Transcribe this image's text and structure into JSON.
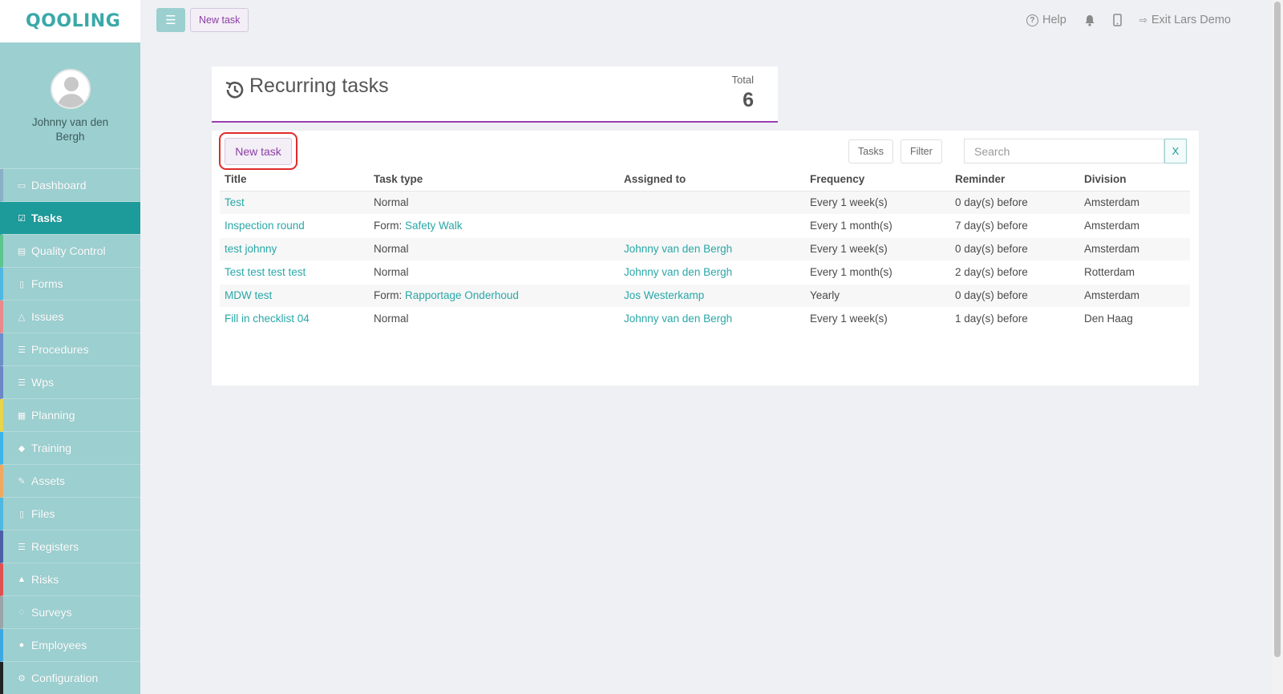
{
  "app": {
    "logo": "QOOLING"
  },
  "profile": {
    "name": "Johnny van den Bergh"
  },
  "sidebar": {
    "items": [
      {
        "label": "Dashboard",
        "icon": "monitor-icon",
        "glyph": "▭",
        "accent": "#8ab0c7"
      },
      {
        "label": "Tasks",
        "icon": "check-square-icon",
        "glyph": "☑",
        "accent": "#1d9a9a"
      },
      {
        "label": "Quality Control",
        "icon": "book-icon",
        "glyph": "▤",
        "accent": "#5cc48e"
      },
      {
        "label": "Forms",
        "icon": "file-icon",
        "glyph": "▯",
        "accent": "#4fb8e0"
      },
      {
        "label": "Issues",
        "icon": "bell-icon",
        "glyph": "△",
        "accent": "#e88a8a"
      },
      {
        "label": "Procedures",
        "icon": "list-icon",
        "glyph": "☰",
        "accent": "#6a8ec9"
      },
      {
        "label": "Wps",
        "icon": "list-icon",
        "glyph": "☰",
        "accent": "#6d86c6"
      },
      {
        "label": "Planning",
        "icon": "calendar-icon",
        "glyph": "▦",
        "accent": "#e8d44d"
      },
      {
        "label": "Training",
        "icon": "graduation-cap-icon",
        "glyph": "◆",
        "accent": "#3db3e8"
      },
      {
        "label": "Assets",
        "icon": "wrench-icon",
        "glyph": "✎",
        "accent": "#f0a860"
      },
      {
        "label": "Files",
        "icon": "file-icon",
        "glyph": "▯",
        "accent": "#4fb8e0"
      },
      {
        "label": "Registers",
        "icon": "list-icon",
        "glyph": "☰",
        "accent": "#4a5fa8"
      },
      {
        "label": "Risks",
        "icon": "warning-icon",
        "glyph": "▲",
        "accent": "#e05050"
      },
      {
        "label": "Surveys",
        "icon": "comment-icon",
        "glyph": "◌",
        "accent": "#9ba5a8"
      },
      {
        "label": "Employees",
        "icon": "users-icon",
        "glyph": "●",
        "accent": "#3da8e0"
      },
      {
        "label": "Configuration",
        "icon": "gear-icon",
        "glyph": "⚙",
        "accent": "#222222"
      }
    ]
  },
  "topbar": {
    "new_task": "New task",
    "help": "Help",
    "exit": "Exit Lars Demo"
  },
  "header": {
    "title": "Recurring tasks",
    "total_label": "Total",
    "total_value": "6"
  },
  "toolbar": {
    "new_task": "New task",
    "tasks": "Tasks",
    "filter": "Filter",
    "search_placeholder": "Search",
    "clear": "X"
  },
  "table": {
    "columns": [
      "Title",
      "Task type",
      "Assigned to",
      "Frequency",
      "Reminder",
      "Division"
    ],
    "rows": [
      {
        "title": "Test",
        "type_prefix": "Normal",
        "type_link": "",
        "assigned": "",
        "frequency": "Every 1 week(s)",
        "reminder": "0 day(s) before",
        "division": "Amsterdam"
      },
      {
        "title": "Inspection round",
        "type_prefix": "Form: ",
        "type_link": "Safety Walk",
        "assigned": "",
        "frequency": "Every 1 month(s)",
        "reminder": "7 day(s) before",
        "division": "Amsterdam"
      },
      {
        "title": "test johnny",
        "type_prefix": "Normal",
        "type_link": "",
        "assigned": "Johnny van den Bergh",
        "frequency": "Every 1 week(s)",
        "reminder": "0 day(s) before",
        "division": "Amsterdam"
      },
      {
        "title": "Test test test test",
        "type_prefix": "Normal",
        "type_link": "",
        "assigned": "Johnny van den Bergh",
        "frequency": "Every 1 month(s)",
        "reminder": "2 day(s) before",
        "division": "Rotterdam"
      },
      {
        "title": "MDW test",
        "type_prefix": "Form: ",
        "type_link": "Rapportage Onderhoud",
        "assigned": "Jos Westerkamp",
        "frequency": "Yearly",
        "reminder": "0 day(s) before",
        "division": "Amsterdam"
      },
      {
        "title": "Fill in checklist 04",
        "type_prefix": "Normal",
        "type_link": "",
        "assigned": "Johnny van den Bergh",
        "frequency": "Every 1 week(s)",
        "reminder": "1 day(s) before",
        "division": "Den Haag"
      }
    ]
  },
  "colors": {
    "accent": "#1d9a9a",
    "sidebar": "#9ccfd0",
    "purple": "#9b3fb0",
    "highlight": "#e02a2a"
  }
}
